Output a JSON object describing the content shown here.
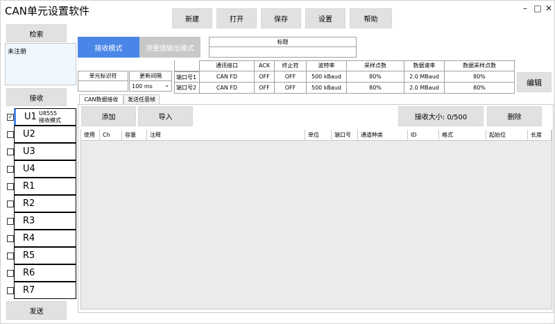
{
  "app": {
    "title": "CAN单元设置软件"
  },
  "window_controls": {
    "minimize": "–",
    "maximize": "□",
    "close": "✕"
  },
  "toolbar": {
    "new": "新建",
    "open": "打开",
    "save": "保存",
    "settings": "设置",
    "help": "帮助"
  },
  "sidebar": {
    "search_label": "检索",
    "status_text": "未注册",
    "receive_label": "接收",
    "send_label": "发送",
    "units": [
      {
        "name": "U1",
        "checked": true,
        "sub1": "U8555",
        "sub2": "接收模式"
      },
      {
        "name": "U2",
        "checked": false
      },
      {
        "name": "U3",
        "checked": false
      },
      {
        "name": "U4",
        "checked": false
      },
      {
        "name": "R1",
        "checked": false
      },
      {
        "name": "R2",
        "checked": false
      },
      {
        "name": "R3",
        "checked": false
      },
      {
        "name": "R4",
        "checked": false
      },
      {
        "name": "R5",
        "checked": false
      },
      {
        "name": "R6",
        "checked": false
      },
      {
        "name": "R7",
        "checked": false
      }
    ]
  },
  "mode": {
    "receive": "接收模式",
    "measure": "测量值输出模式"
  },
  "colors": {
    "accent": "#4a86e8",
    "mode_inactive": "#c8c8c8",
    "grid_bg": "#ebebeb"
  },
  "title_box": {
    "label": "标题",
    "value": ""
  },
  "unit_id": {
    "label": "单元标识符",
    "value": ""
  },
  "update_interval": {
    "label": "更新间隔",
    "value": "100 ms"
  },
  "port_table": {
    "headers": [
      "通讯接口",
      "ACK",
      "终止符",
      "波特率",
      "采样点数",
      "数据速率",
      "数据采样点数"
    ],
    "rows": [
      {
        "port": "端口号1",
        "cells": [
          "CAN FD",
          "OFF",
          "OFF",
          "500 kBaud",
          "80%",
          "2.0 MBaud",
          "80%"
        ]
      },
      {
        "port": "端口号2",
        "cells": [
          "CAN FD",
          "OFF",
          "OFF",
          "500 kBaud",
          "80%",
          "2.0 MBaud",
          "80%"
        ]
      }
    ]
  },
  "edit_button": "编辑",
  "tabs": {
    "receive": "CAN数据接收",
    "send": "发送任意帧"
  },
  "actions": {
    "add": "添加",
    "import": "导入",
    "recv_size": "接收大小: 0/500",
    "delete": "删除"
  },
  "grid_headers": [
    "使用",
    "Ch",
    "容量",
    "注释",
    "单位",
    "端口号",
    "通道种类",
    "ID",
    "格式",
    "起始位",
    "长度"
  ]
}
